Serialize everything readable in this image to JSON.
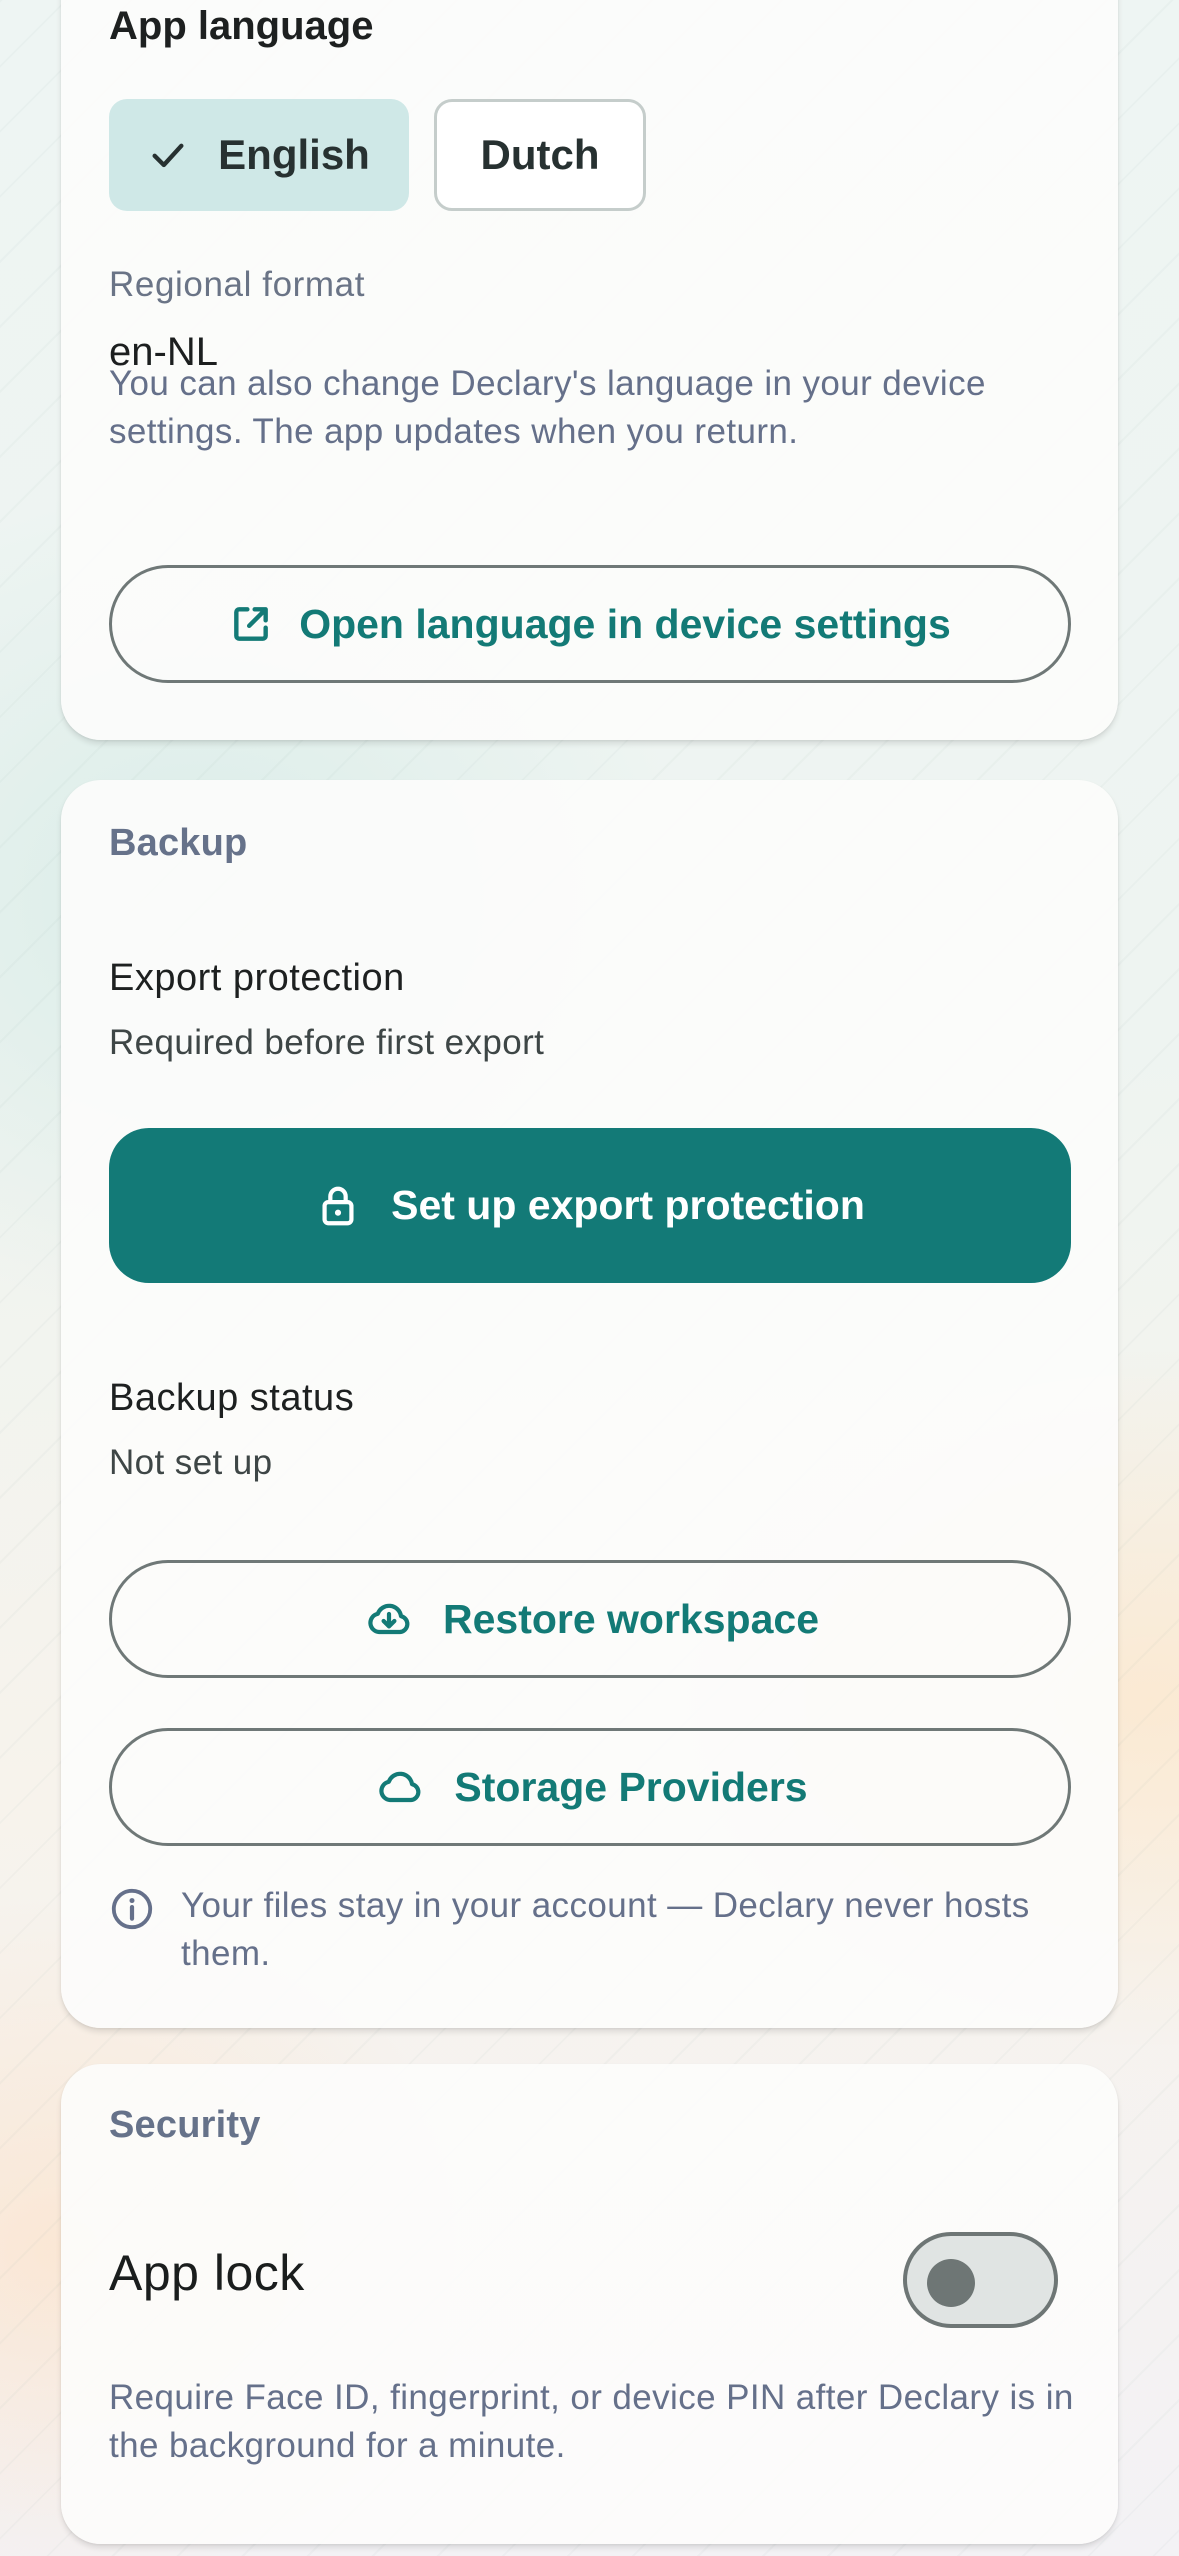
{
  "language": {
    "title": "App language",
    "options": [
      {
        "label": "English",
        "selected": true
      },
      {
        "label": "Dutch",
        "selected": false
      }
    ],
    "regional_label": "Regional format",
    "regional_value": "en-NL",
    "help": "You can also change Declary's language in your device settings. The app updates when you return.",
    "open_settings_label": "Open language in device settings"
  },
  "backup": {
    "heading": "Backup",
    "export_title": "Export protection",
    "export_sub": "Required before first export",
    "setup_export_label": "Set up export protection",
    "status_title": "Backup status",
    "status_value": "Not set up",
    "restore_label": "Restore workspace",
    "providers_label": "Storage Providers",
    "info_text": "Your files stay in your account — Declary never hosts them."
  },
  "security": {
    "heading": "Security",
    "app_lock_label": "App lock",
    "app_lock_enabled": false,
    "help": "Require Face ID, fingerprint, or device PIN after Declary is in the background for a minute."
  },
  "colors": {
    "accent": "#137a77",
    "chip_selected": "#cfe8e7",
    "heading": "#66728a"
  },
  "icons": [
    "check-icon",
    "external-link-icon",
    "lock-icon",
    "cloud-download-icon",
    "cloud-icon",
    "info-icon"
  ]
}
